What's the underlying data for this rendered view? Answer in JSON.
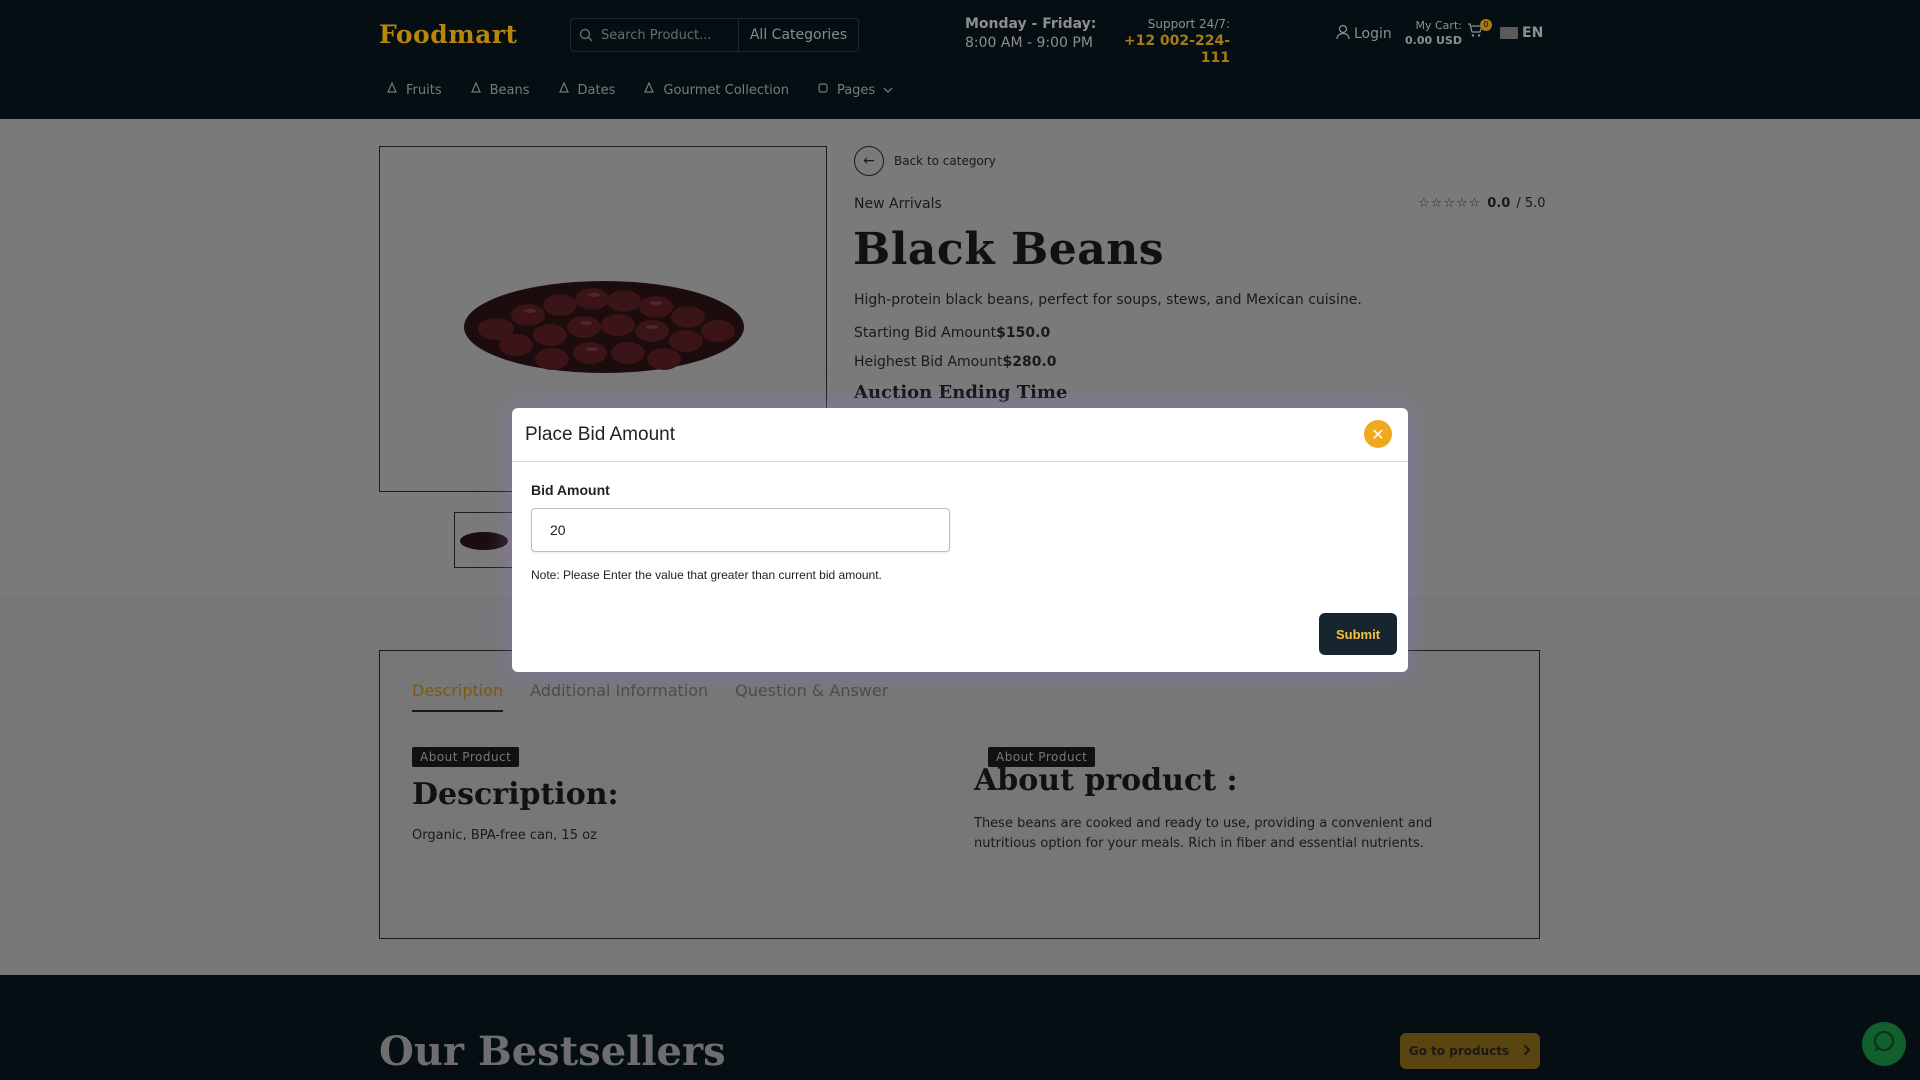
{
  "header": {
    "logo": "Foodmart",
    "search_placeholder": "Search Product...",
    "category_select": "All Categories",
    "hours_days": "Monday - Friday:",
    "hours_time": "8:00 AM - 9:00 PM",
    "support_label": "Support 24/7:",
    "support_phone": "+12 002-224-111",
    "login_label": "Login",
    "cart_label": "My Cart:",
    "cart_value": "0.00 USD",
    "cart_count": "0",
    "language": "EN"
  },
  "nav": {
    "items": [
      {
        "label": "Fruits",
        "icon": "leaf-icon"
      },
      {
        "label": "Beans",
        "icon": "leaf-icon"
      },
      {
        "label": "Dates",
        "icon": "leaf-icon"
      },
      {
        "label": "Gourmet Collection",
        "icon": "leaf-icon"
      },
      {
        "label": "Pages",
        "icon": "page-icon"
      }
    ]
  },
  "product": {
    "back_label": "Back to category",
    "tag": "New Arrivals",
    "rating_value": "0.0",
    "rating_max": "/ 5.0",
    "title": "Black Beans",
    "description": "High-protein black beans, perfect for soups, stews, and Mexican cuisine.",
    "starting_bid_label": "Starting Bid Amount",
    "starting_bid_value": "$150.0",
    "highest_bid_label": "Heighest Bid Amount",
    "highest_bid_value": "$280.0",
    "auction_heading": "Auction Ending Time"
  },
  "tabs": {
    "items": [
      "Description",
      "Additional Information",
      "Question & Answer"
    ],
    "active": "Description",
    "col1_pill": "About Product",
    "col1_heading": "Description:",
    "col1_text": "Organic, BPA-free can, 15 oz",
    "col2_pill": "About Product",
    "col2_heading": "About product :",
    "col2_text": "These beans are cooked and ready to use, providing a convenient and nutritious option for your meals. Rich in fiber and essential nutrients."
  },
  "bestsellers": {
    "heading": "Our Bestsellers",
    "button": "Go to products"
  },
  "modal": {
    "title": "Place Bid Amount",
    "field_label": "Bid Amount",
    "field_value": "20",
    "note": "Note: Please Enter the value that greater than current bid amount.",
    "submit": "Submit"
  },
  "colors": {
    "header_bg": "#040e13",
    "accent": "#f0a81f",
    "submit_bg": "#17262e",
    "submit_text": "#f2c14e"
  }
}
